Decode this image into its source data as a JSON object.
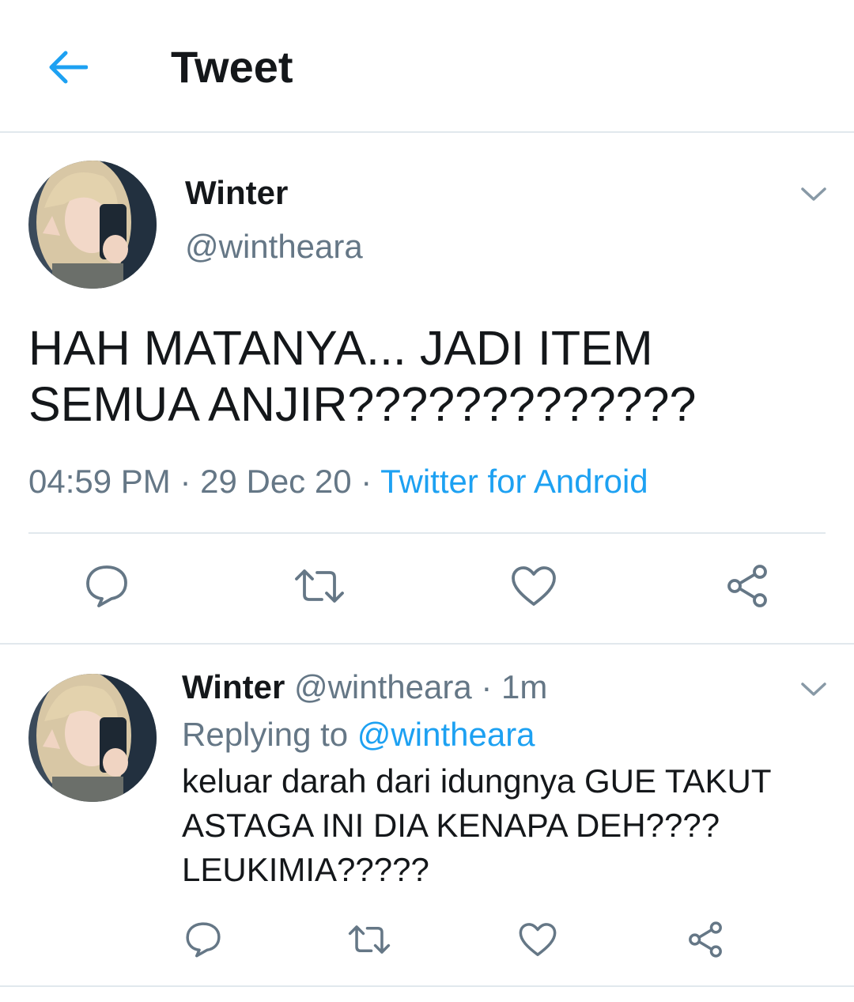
{
  "header": {
    "title": "Tweet",
    "back_icon": "arrow-left-icon"
  },
  "colors": {
    "accent": "#1da1f2",
    "text_primary": "#14171a",
    "text_secondary": "#657786",
    "divider": "#e1e8ed"
  },
  "tweet": {
    "display_name": "Winter",
    "handle": "@wintheara",
    "text_line1": "HAH MATANYA... JADI ITEM",
    "text_line2": "SEMUA ANJIR?????????????",
    "time": "04:59 PM",
    "date": "29 Dec 20",
    "separator": " · ",
    "source": "Twitter for Android",
    "actions": [
      "reply-icon",
      "retweet-icon",
      "like-icon",
      "share-icon"
    ]
  },
  "reply": {
    "display_name": "Winter",
    "handle": "@wintheara",
    "separator": " · ",
    "time_ago": "1m",
    "replying_label": "Replying to",
    "replying_to": "@wintheara",
    "text_line1": "keluar darah dari idungnya GUE TAKUT",
    "text_line2": "ASTAGA INI DIA KENAPA DEH????",
    "text_line3": "LEUKIMIA?????",
    "actions": [
      "reply-icon",
      "retweet-icon",
      "like-icon",
      "share-icon"
    ]
  }
}
